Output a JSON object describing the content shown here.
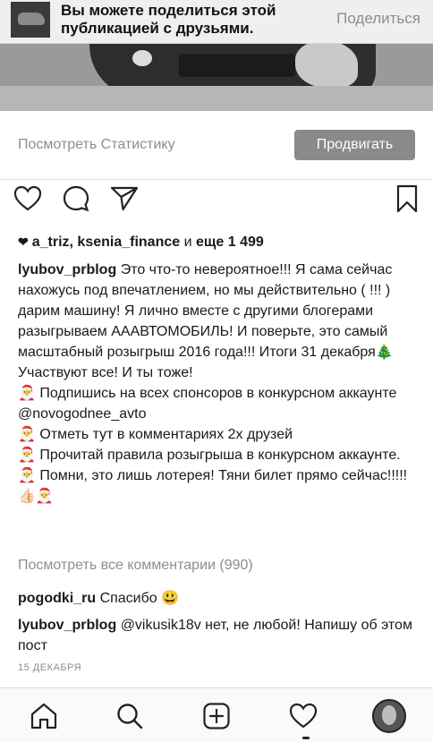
{
  "banner": {
    "text": "Вы можете поделиться этой публикацией с друзьями.",
    "share_label": "Поделиться"
  },
  "stats": {
    "view_label": "Посмотреть Статистику",
    "promote_label": "Продвигать"
  },
  "actions": {
    "icons": [
      "heart-icon",
      "comment-icon",
      "share-icon",
      "bookmark-icon"
    ]
  },
  "likes": {
    "users": "a_triz, ksenia_finance",
    "connector": " и ",
    "more": "еще 1 499"
  },
  "caption": {
    "username": "lyubov_prblog",
    "text": "Это что-то невероятное!!! Я сама сейчас нахожусь под впечатлением, но мы действительно ( !!! ) дарим машину! Я лично вместе с другими блогерами разыгрываем ААAВТОМОБИЛЬ! И поверьте, это самый масштабный розыгрыш 2016 года!!! Итоги 31 декабря🎄 Участвуют все! И ты тоже!",
    "items": [
      "🎅 Подпишись на всех спонсоров в конкурсном аккаунте @novogodnee_avto",
      "🎅 Отметь тут в комментариях 2х друзей",
      "🎅 Прочитай правила розыгрыша в конкурсном аккаунте.",
      "🎅 Помни, это лишь лотерея! Тяни билет прямо сейчас!!!!!👍🏻🎅"
    ]
  },
  "view_all_comments": "Посмотреть все комментарии (990)",
  "comments": [
    {
      "username": "pogodki_ru",
      "text": "Спасибо 😃"
    },
    {
      "username": "lyubov_prblog",
      "text": "@vikusik18v нет, не любой! Напишу об этом пост"
    }
  ],
  "date": "15 ДЕКАБРЯ",
  "bottom_nav": {
    "icons": [
      "home-icon",
      "search-icon",
      "add-post-icon",
      "activity-heart-icon",
      "profile-avatar"
    ]
  }
}
